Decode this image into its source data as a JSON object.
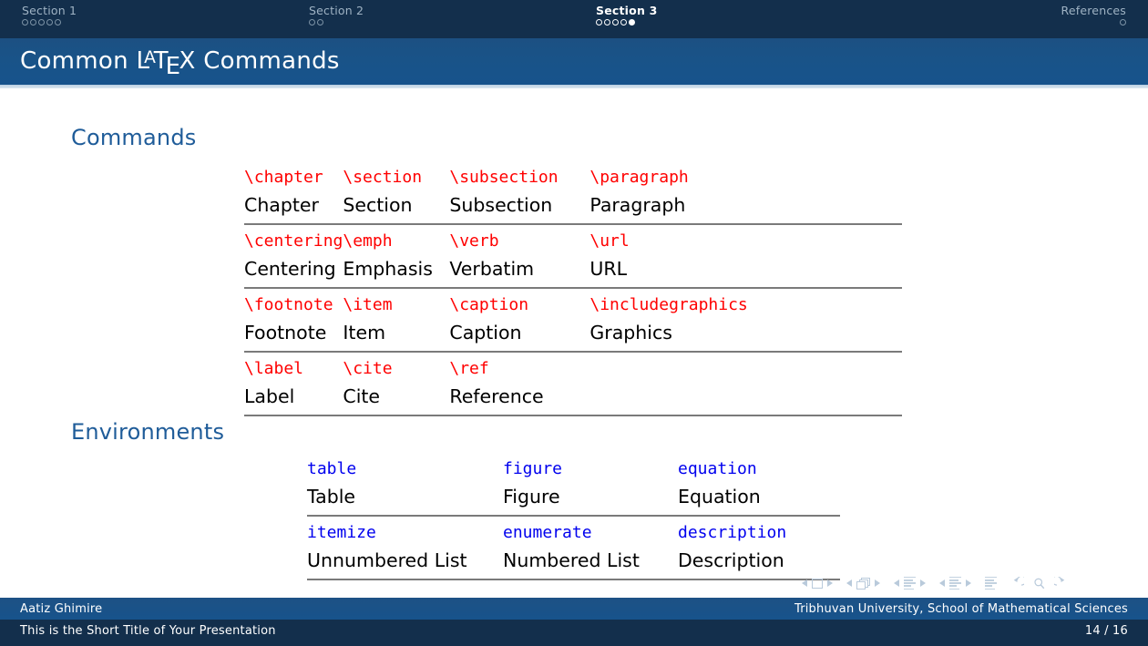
{
  "navigation": {
    "sections": [
      {
        "label": "Section 1",
        "slides": 5,
        "current": -1,
        "active": false
      },
      {
        "label": "Section 2",
        "slides": 2,
        "current": -1,
        "active": false
      },
      {
        "label": "Section 3",
        "slides": 5,
        "current": 4,
        "active": true
      },
      {
        "label": "References",
        "slides": 1,
        "current": -1,
        "active": false
      }
    ]
  },
  "frame": {
    "title_prefix": "Common ",
    "latex_l": "L",
    "latex_a": "A",
    "latex_t": "T",
    "latex_e": "E",
    "latex_x": "X",
    "title_suffix": " Commands"
  },
  "blocks": {
    "commands": {
      "heading": "Commands",
      "rows": [
        {
          "commands": [
            "\\chapter",
            "\\section",
            "\\subsection",
            "\\paragraph"
          ],
          "descriptions": [
            "Chapter",
            "Section",
            "Subsection",
            "Paragraph"
          ]
        },
        {
          "commands": [
            "\\centering",
            "\\emph",
            "\\verb",
            "\\url"
          ],
          "descriptions": [
            "Centering",
            "Emphasis",
            "Verbatim",
            "URL"
          ]
        },
        {
          "commands": [
            "\\footnote",
            "\\item",
            "\\caption",
            "\\includegraphics"
          ],
          "descriptions": [
            "Footnote",
            "Item",
            "Caption",
            "Graphics"
          ]
        },
        {
          "commands": [
            "\\label",
            "\\cite",
            "\\ref",
            ""
          ],
          "descriptions": [
            "Label",
            "Cite",
            "Reference",
            ""
          ]
        }
      ]
    },
    "environments": {
      "heading": "Environments",
      "rows": [
        {
          "environments": [
            "table",
            "figure",
            "equation"
          ],
          "descriptions": [
            "Table",
            "Figure",
            "Equation"
          ]
        },
        {
          "environments": [
            "itemize",
            "enumerate",
            "description"
          ],
          "descriptions": [
            "Unnumbered List",
            "Numbered List",
            "Description"
          ]
        }
      ]
    }
  },
  "footer": {
    "author": "Aatiz Ghimire",
    "institute": "Tribhuvan University, School of Mathematical Sciences",
    "short_title": "This is the Short Title of Your Presentation",
    "page": "14 / 16"
  },
  "colors": {
    "command_red": "#ff0000",
    "environment_blue": "#0000ee",
    "heading_blue": "#1f5c99",
    "bar_dark": "#132f4c",
    "bar_medium": "#17538c"
  }
}
